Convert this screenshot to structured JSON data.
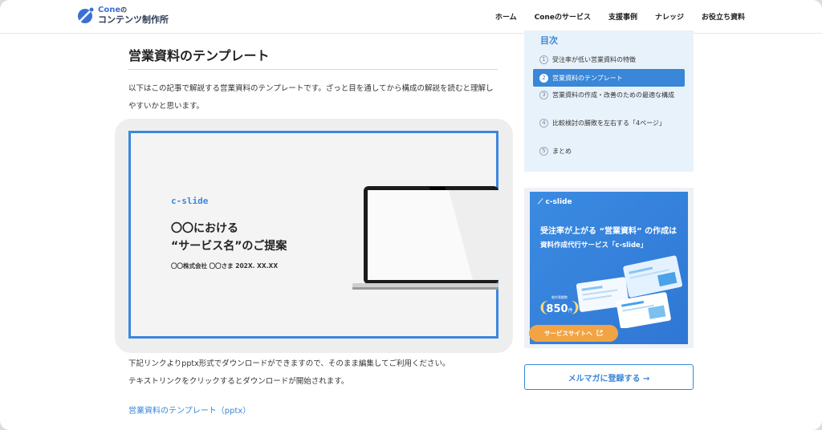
{
  "header": {
    "logo_line1": "Cone",
    "logo_no": "の",
    "logo_line2": "コンテンツ制作所",
    "nav": [
      "ホーム",
      "Coneのサービス",
      "支援事例",
      "ナレッジ",
      "お役立ち資料"
    ]
  },
  "article": {
    "title": "営業資料のテンプレート",
    "intro": "以下はこの記事で解説する営業資料のテンプレートです。ざっと目を通してから構成の解説を読むと理解しやすいかと思います。",
    "slide": {
      "brand": "c-slide",
      "heading_line1": "〇〇における",
      "heading_line2": "“サービス名”のご提案",
      "sub": "〇〇株式会社 〇〇さま 202X. XX.XX"
    },
    "download_text_1": "下記リンクよりpptx形式でダウンロードができますので、そのまま編集してご利用ください。",
    "download_text_2": "テキストリンクをクリックするとダウンロードが開始されます。",
    "download_link": "営業資料のテンプレート（pptx）"
  },
  "toc": {
    "title": "目次",
    "items": [
      {
        "num": "1",
        "label": "受注率が低い営業資料の特徴"
      },
      {
        "num": "2",
        "label": "営業資料のテンプレート"
      },
      {
        "num": "3",
        "label": "営業資料の作成・改善のための最適な構成"
      },
      {
        "num": "4",
        "label": "比較検討の勝敗を左右する「4ページ」"
      },
      {
        "num": "5",
        "label": "まとめ"
      }
    ],
    "active_index": 1
  },
  "banner": {
    "brand": "c-slide",
    "headline": "受注率が上がる “営業資料” の作成は",
    "subline": "資料作成代行サービス「c-slide」",
    "count_label": "制作実績数",
    "count": "850",
    "count_unit": "件",
    "button": "サービスサイトへ"
  },
  "newsletter_button": "メルマガに登録する →",
  "colors": {
    "accent": "#3a86d8",
    "orange": "#f2a445",
    "toc_bg": "#e8f2fb"
  }
}
